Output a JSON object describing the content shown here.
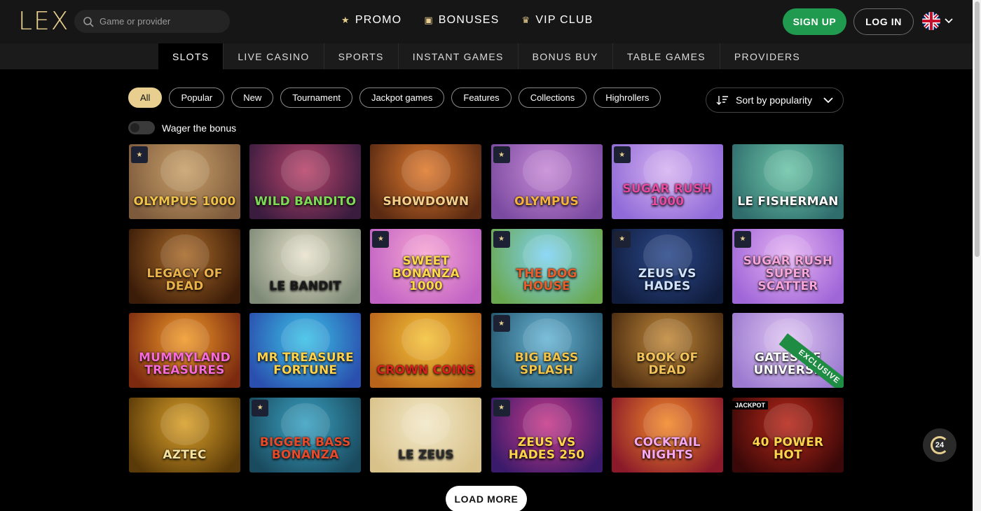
{
  "header": {
    "logo": "LEX",
    "search_placeholder": "Game or provider",
    "nav": [
      {
        "icon": "star-icon",
        "label": "PROMO"
      },
      {
        "icon": "gift-icon",
        "label": "BONUSES"
      },
      {
        "icon": "crown-icon",
        "label": "VIP CLUB"
      }
    ],
    "signup_label": "SIGN UP",
    "login_label": "LOG IN",
    "language_icon": "uk-flag-icon"
  },
  "categories": [
    {
      "label": "SLOTS",
      "active": true
    },
    {
      "label": "LIVE CASINO",
      "active": false
    },
    {
      "label": "SPORTS",
      "active": false
    },
    {
      "label": "INSTANT GAMES",
      "active": false
    },
    {
      "label": "BONUS BUY",
      "active": false
    },
    {
      "label": "TABLE GAMES",
      "active": false
    },
    {
      "label": "PROVIDERS",
      "active": false
    }
  ],
  "filters": {
    "chips": [
      {
        "label": "All",
        "active": true
      },
      {
        "label": "Popular",
        "active": false
      },
      {
        "label": "New",
        "active": false
      },
      {
        "label": "Tournament",
        "active": false
      },
      {
        "label": "Jackpot games",
        "active": false
      },
      {
        "label": "Features",
        "active": false
      },
      {
        "label": "Collections",
        "active": false
      },
      {
        "label": "Highrollers",
        "active": false
      }
    ],
    "sort_label": "Sort by popularity",
    "wager_label": "Wager the bonus",
    "wager_on": false
  },
  "games": [
    {
      "title": "OLYMPUS 1000",
      "dropswins": true,
      "bg": [
        "#c9a16a",
        "#7d5a3c"
      ],
      "fg": "#f1c24a"
    },
    {
      "title": "WILD BANDITO",
      "dropswins": false,
      "bg": [
        "#b9456b",
        "#3a1c3f"
      ],
      "fg": "#7ed957"
    },
    {
      "title": "SHOWDOWN",
      "dropswins": false,
      "bg": [
        "#e07b2f",
        "#5a2a12"
      ],
      "fg": "#f6d08a"
    },
    {
      "title": "OLYMPUS",
      "dropswins": true,
      "bg": [
        "#c88bd6",
        "#7a4aa0"
      ],
      "fg": "#f3b23a"
    },
    {
      "title": "SUGAR RUSH 1000",
      "dropswins": true,
      "bg": [
        "#d8b4f0",
        "#8f6ad8"
      ],
      "fg": "#e64ba0"
    },
    {
      "title": "LE FISHERMAN",
      "dropswins": false,
      "bg": [
        "#6ec6a8",
        "#2f6d6d"
      ],
      "fg": "#ffffff"
    },
    {
      "title": "LEGACY OF DEAD",
      "dropswins": false,
      "bg": [
        "#a86a2a",
        "#3b1c08"
      ],
      "fg": "#e9b24a"
    },
    {
      "title": "LE BANDIT",
      "dropswins": false,
      "bg": [
        "#e9e3cf",
        "#7e8a76"
      ],
      "fg": "#1a1a1a"
    },
    {
      "title": "SWEET BONANZA 1000",
      "dropswins": true,
      "bg": [
        "#f7a6d3",
        "#c061c4"
      ],
      "fg": "#ffd84a"
    },
    {
      "title": "THE DOG HOUSE",
      "dropswins": true,
      "bg": [
        "#7fd3f5",
        "#6aa84f"
      ],
      "fg": "#e55d2a"
    },
    {
      "title": "ZEUS VS HADES",
      "dropswins": true,
      "bg": [
        "#2c4a8c",
        "#101c3c"
      ],
      "fg": "#cfe2ff"
    },
    {
      "title": "SUGAR RUSH SUPER SCATTER",
      "dropswins": true,
      "bg": [
        "#e6b3f2",
        "#9f66d8"
      ],
      "fg": "#f6a4d9"
    },
    {
      "title": "MUMMYLAND TREASURES",
      "dropswins": false,
      "bg": [
        "#f19b2a",
        "#7b2a10"
      ],
      "fg": "#f76bd8"
    },
    {
      "title": "MR TREASURE FORTUNE",
      "dropswins": false,
      "bg": [
        "#3cc2e6",
        "#2a4fae"
      ],
      "fg": "#ffd24a"
    },
    {
      "title": "CROWN COINS",
      "dropswins": false,
      "bg": [
        "#f4c33a",
        "#b8641a"
      ],
      "fg": "#d9211c"
    },
    {
      "title": "BIG BASS SPLASH",
      "dropswins": true,
      "bg": [
        "#6ab6d6",
        "#24566e"
      ],
      "fg": "#f3c44a"
    },
    {
      "title": "BOOK OF DEAD",
      "dropswins": false,
      "bg": [
        "#c18a3c",
        "#4b2b10"
      ],
      "fg": "#f1c35a"
    },
    {
      "title": "GATES OF UNIVERSE",
      "dropswins": false,
      "bg": [
        "#e0c6f2",
        "#9b7ad0"
      ],
      "fg": "#ffffff",
      "badge": "EXCLUSIVE"
    },
    {
      "title": "AZTEC",
      "dropswins": false,
      "bg": [
        "#d9a02a",
        "#5a3a08"
      ],
      "fg": "#f7e3a0"
    },
    {
      "title": "BIGGER BASS BONANZA",
      "dropswins": true,
      "bg": [
        "#3aa2c2",
        "#1a4a5e"
      ],
      "fg": "#e54a2a"
    },
    {
      "title": "LE ZEUS",
      "dropswins": false,
      "bg": [
        "#f2e8c8",
        "#d9c28a"
      ],
      "fg": "#2a2a2a"
    },
    {
      "title": "ZEUS VS HADES 250",
      "dropswins": true,
      "bg": [
        "#c83a8a",
        "#3a1a6a"
      ],
      "fg": "#ffd44a"
    },
    {
      "title": "COCKTAIL NIGHTS",
      "dropswins": false,
      "bg": [
        "#f28a2a",
        "#8a1a2a"
      ],
      "fg": "#f7a6f0"
    },
    {
      "title": "40 POWER HOT",
      "dropswins": false,
      "bg": [
        "#b8281a",
        "#3a0808"
      ],
      "fg": "#ffd44a",
      "jackpot": "JACKPOT"
    }
  ],
  "load_more_label": "LOAD MORE",
  "support_label": "24"
}
